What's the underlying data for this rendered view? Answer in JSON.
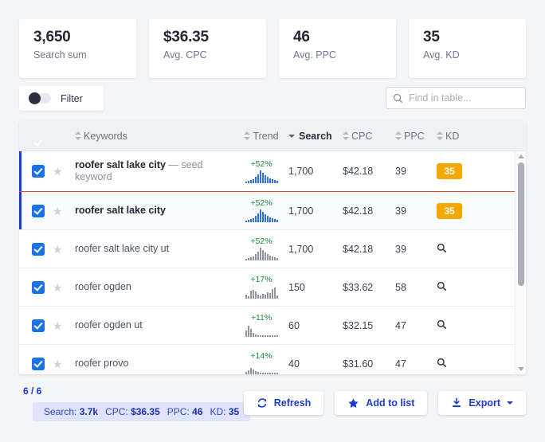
{
  "stats": [
    {
      "value": "3,650",
      "label": "Search sum"
    },
    {
      "value": "$36.35",
      "label": "Avg. CPC"
    },
    {
      "value": "46",
      "label": "Avg. PPC"
    },
    {
      "value": "35",
      "label": "Avg. KD"
    }
  ],
  "toolbar": {
    "filter_label": "Filter",
    "filter_toggle_state": "off",
    "search_icon": "search-icon",
    "search_placeholder": "Find in table...",
    "search_value": ""
  },
  "table": {
    "select_all_checked": true,
    "columns": [
      {
        "key": "keywords",
        "label": "Keywords",
        "sort": "none"
      },
      {
        "key": "trend",
        "label": "Trend",
        "sort": "none"
      },
      {
        "key": "search",
        "label": "Search",
        "sort": "desc"
      },
      {
        "key": "cpc",
        "label": "CPC",
        "sort": "none"
      },
      {
        "key": "ppc",
        "label": "PPC",
        "sort": "none"
      },
      {
        "key": "kd",
        "label": "KD",
        "sort": "none"
      }
    ],
    "rows": [
      {
        "checked": true,
        "starred": false,
        "star_icon": "star-icon",
        "keyword": "roofer salt lake city",
        "suffix": " — seed keyword",
        "is_seed": true,
        "highlighted": true,
        "trend_pct": "+52%",
        "search": "1,700",
        "cpc": "$42.18",
        "ppc": "39",
        "kd": "35",
        "kd_type": "badge",
        "spark": [
          2,
          3,
          4,
          5,
          8,
          11,
          16,
          13,
          10,
          8,
          6,
          5,
          4,
          3
        ],
        "spark_color": "blue"
      },
      {
        "checked": true,
        "starred": false,
        "star_icon": "star-icon",
        "keyword": "roofer salt lake city",
        "suffix": "",
        "is_seed": false,
        "highlighted": true,
        "trend_pct": "+52%",
        "search": "1,700",
        "cpc": "$42.18",
        "ppc": "39",
        "kd": "35",
        "kd_type": "badge",
        "spark": [
          2,
          3,
          4,
          5,
          8,
          11,
          16,
          13,
          10,
          8,
          6,
          5,
          4,
          3
        ],
        "spark_color": "blue"
      },
      {
        "checked": true,
        "starred": false,
        "star_icon": "star-icon",
        "keyword": "roofer salt lake city ut",
        "suffix": "",
        "is_seed": false,
        "highlighted": false,
        "trend_pct": "+52%",
        "search": "1,700",
        "cpc": "$42.18",
        "ppc": "39",
        "kd": "",
        "kd_type": "search-icon",
        "spark": [
          2,
          3,
          4,
          5,
          8,
          11,
          16,
          13,
          10,
          8,
          6,
          5,
          4,
          3
        ],
        "spark_color": "gray"
      },
      {
        "checked": true,
        "starred": false,
        "star_icon": "star-icon",
        "keyword": "roofer ogden",
        "suffix": "",
        "is_seed": false,
        "highlighted": false,
        "trend_pct": "+17%",
        "search": "150",
        "cpc": "$33.62",
        "ppc": "58",
        "kd": "",
        "kd_type": "search-icon",
        "spark": [
          5,
          3,
          10,
          11,
          9,
          5,
          4,
          6,
          5,
          8,
          7,
          12,
          14,
          4
        ],
        "spark_color": "gray"
      },
      {
        "checked": true,
        "starred": false,
        "star_icon": "star-icon",
        "keyword": "roofer ogden ut",
        "suffix": "",
        "is_seed": false,
        "highlighted": false,
        "trend_pct": "+11%",
        "search": "60",
        "cpc": "$32.15",
        "ppc": "47",
        "kd": "",
        "kd_type": "search-icon",
        "spark": [
          8,
          14,
          10,
          5,
          3,
          2,
          2,
          2,
          2,
          2,
          2,
          2,
          2,
          2
        ],
        "spark_color": "gray"
      },
      {
        "checked": true,
        "starred": false,
        "star_icon": "star-icon",
        "keyword": "roofer provo",
        "suffix": "",
        "is_seed": false,
        "highlighted": false,
        "trend_pct": "+14%",
        "search": "40",
        "cpc": "$31.60",
        "ppc": "47",
        "kd": "",
        "kd_type": "search-icon",
        "spark": [
          4,
          6,
          9,
          7,
          5,
          4,
          3,
          3,
          3,
          3,
          3,
          3,
          3,
          3
        ],
        "spark_color": "gray"
      }
    ],
    "scrollbar": {
      "up_icon": "caret-up-icon",
      "down_icon": "caret-down-icon"
    }
  },
  "footer": {
    "count": "6 / 6",
    "summary": [
      {
        "label": "Search:",
        "value": "3.7k"
      },
      {
        "label": "CPC:",
        "value": "$36.35"
      },
      {
        "label": "PPC:",
        "value": "46"
      },
      {
        "label": "KD:",
        "value": "35"
      }
    ],
    "buttons": [
      {
        "label": "Refresh",
        "icon": "refresh-icon",
        "caret": false
      },
      {
        "label": "Add to list",
        "icon": "star-icon",
        "caret": false
      },
      {
        "label": "Export",
        "icon": "download-icon",
        "caret": true
      }
    ]
  },
  "colors": {
    "accent_blue": "#1d3ad6",
    "checkbox_blue": "#1a73e8",
    "kd_amber": "#f5a800",
    "trend_green": "#1e8a3c",
    "seed_divider_red": "#e8472c",
    "page_bg": "#f4f5f7"
  }
}
